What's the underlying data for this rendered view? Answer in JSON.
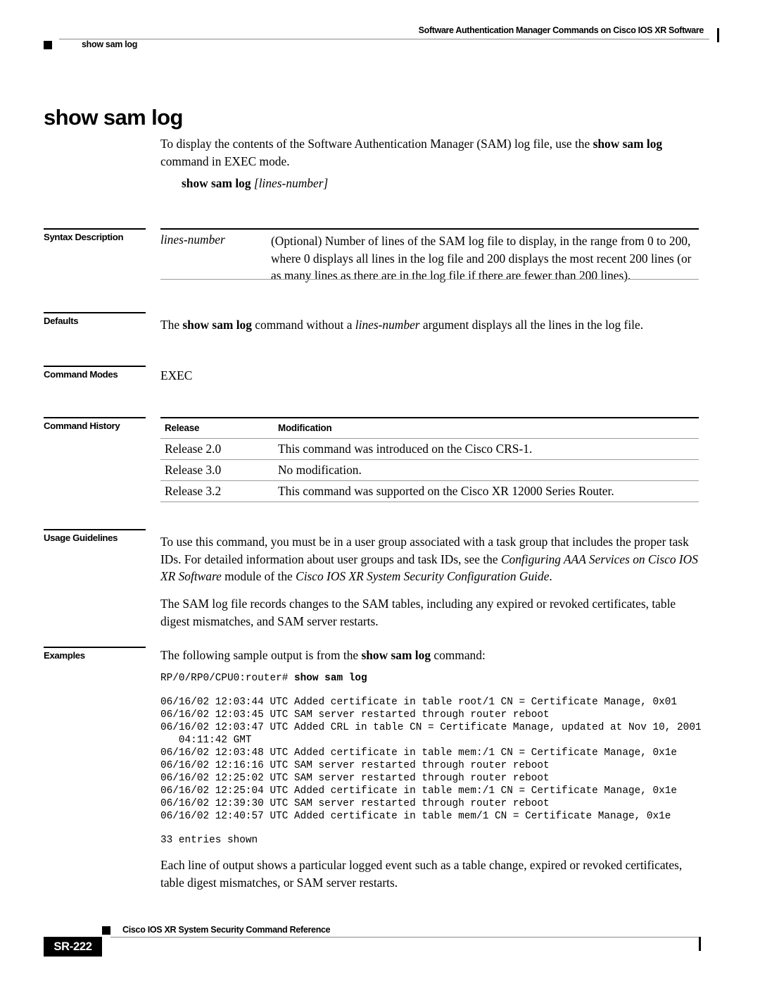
{
  "header": {
    "title": "Software Authentication Manager Commands on Cisco IOS XR Software",
    "breadcrumb": "show sam log"
  },
  "page_title": "show sam log",
  "intro": {
    "text_before": "To display the contents of the Software Authentication Manager (SAM) log file, use the ",
    "command": "show sam log",
    "text_after": " command in EXEC mode."
  },
  "syntax": {
    "command": "show sam log",
    "argument": "[lines-number]"
  },
  "sections": {
    "syntax_description": "Syntax Description",
    "defaults": "Defaults",
    "command_modes": "Command Modes",
    "command_history": "Command History",
    "usage_guidelines": "Usage Guidelines",
    "examples": "Examples"
  },
  "syntax_description": {
    "term": "lines-number",
    "description": "(Optional) Number of lines of the SAM log file to display, in the range from 0 to 200, where 0 displays all lines in the log file and 200 displays the most recent 200 lines (or as many lines as there are in the log file if there are fewer than 200 lines)."
  },
  "defaults": {
    "before": "The ",
    "command": "show sam log",
    "middle": " command without a ",
    "argument": "lines-number",
    "after": " argument displays all the lines in the log file."
  },
  "command_modes": {
    "value": "EXEC"
  },
  "command_history": {
    "columns": [
      "Release",
      "Modification"
    ],
    "rows": [
      [
        "Release 2.0",
        "This command was introduced on the Cisco CRS-1."
      ],
      [
        "Release 3.0",
        "No modification."
      ],
      [
        "Release 3.2",
        "This command was supported on the Cisco XR 12000 Series Router."
      ]
    ]
  },
  "usage_guidelines": {
    "para1_a": "To use this command, you must be in a user group associated with a task group that includes the proper task IDs. For detailed information about user groups and task IDs, see the ",
    "para1_b": "Configuring AAA Services on Cisco IOS XR Software",
    "para1_c": " module of the ",
    "para1_d": "Cisco IOS XR System Security Configuration Guide",
    "para1_e": ".",
    "para2": "The SAM log file records changes to the SAM tables, including any expired or revoked certificates, table digest mismatches, and SAM server restarts."
  },
  "examples": {
    "lead_before": "The following sample output is from the ",
    "lead_command": "show sam log",
    "lead_after": " command:",
    "prompt": "RP/0/RP0/CPU0:router# ",
    "prompt_command": "show sam log",
    "output_lines": [
      "06/16/02 12:03:44 UTC Added certificate in table root/1 CN = Certificate Manage, 0x01",
      "06/16/02 12:03:45 UTC SAM server restarted through router reboot",
      "06/16/02 12:03:47 UTC Added CRL in table CN = Certificate Manage, updated at Nov 10, 2001",
      "   04:11:42 GMT",
      "06/16/02 12:03:48 UTC Added certificate in table mem:/1 CN = Certificate Manage, 0x1e",
      "06/16/02 12:16:16 UTC SAM server restarted through router reboot",
      "06/16/02 12:25:02 UTC SAM server restarted through router reboot",
      "06/16/02 12:25:04 UTC Added certificate in table mem:/1 CN = Certificate Manage, 0x1e",
      "06/16/02 12:39:30 UTC SAM server restarted through router reboot",
      "06/16/02 12:40:57 UTC Added certificate in table mem/1 CN = Certificate Manage, 0x1e"
    ],
    "entries_shown": "33 entries shown",
    "trailing_para": "Each line of output shows a particular logged event such as a table change, expired or revoked certificates, table digest mismatches, or SAM server restarts."
  },
  "footer": {
    "page_number": "SR-222",
    "title": "Cisco IOS XR System Security Command Reference"
  }
}
